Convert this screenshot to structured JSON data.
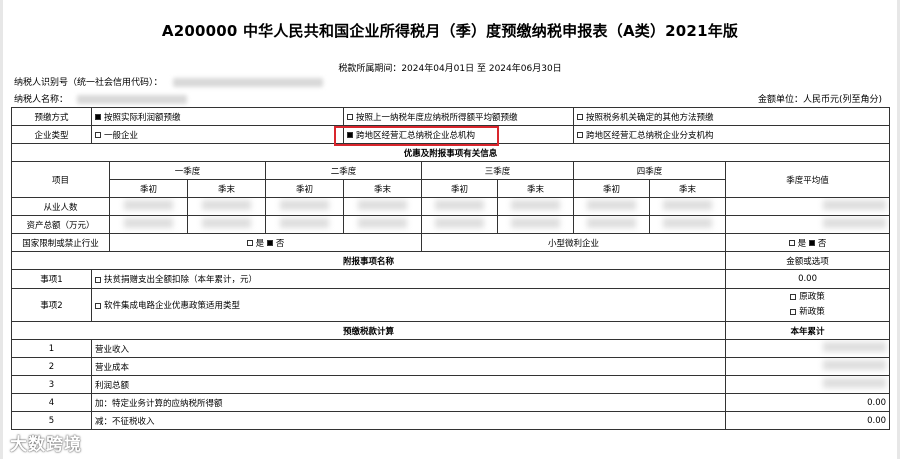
{
  "title": "A200000 中华人民共和国企业所得税月（季）度预缴纳税申报表（A类）2021年版",
  "period": "税款所属期间：2024年04月01日 至 2024年06月30日",
  "taxpayer_id_label": "纳税人识别号（统一社会信用代码）：",
  "taxpayer_name_label": "纳税人名称：",
  "amount_unit": "金额单位：人民币元(列至角分)",
  "prepay_method": {
    "label": "预缴方式",
    "options": [
      "按照实际利润额预缴",
      "按照上一纳税年度应纳税所得额平均额预缴",
      "按照税务机关确定的其他方法预缴"
    ]
  },
  "enterprise_type": {
    "label": "企业类型",
    "options": [
      "一般企业",
      "跨地区经营汇总纳税企业总机构",
      "跨地区经营汇总纳税企业分支机构"
    ]
  },
  "preferential_header": "优惠及附报事项有关信息",
  "item_label": "项目",
  "quarters": [
    "一季度",
    "二季度",
    "三季度",
    "四季度"
  ],
  "q_start": "季初",
  "q_end": "季末",
  "quarter_avg": "季度平均值",
  "rows": {
    "employees": "从业人数",
    "assets": "资产总额（万元）",
    "restricted": "国家限制或禁止行业",
    "small": "小型微利企业"
  },
  "yes": "是",
  "no": "否",
  "attach_header": "附报事项名称",
  "amount_or_option": "金额或选项",
  "item1": {
    "label": "事项1",
    "desc": "扶贫捐赠支出全额扣除（本年累计，元）",
    "value": "0.00"
  },
  "item2": {
    "label": "事项2",
    "desc": "软件集成电路企业优惠政策适用类型",
    "opt_a": "原政策",
    "opt_b": "新政策"
  },
  "calc_header": "预缴税款计算",
  "year_total": "本年累计",
  "calc_rows": [
    {
      "no": "1",
      "name": "营业收入",
      "value": ""
    },
    {
      "no": "2",
      "name": "营业成本",
      "value": ""
    },
    {
      "no": "3",
      "name": "利润总额",
      "value": ""
    },
    {
      "no": "4",
      "name": "加：特定业务计算的应纳税所得额",
      "value": "0.00"
    },
    {
      "no": "5",
      "name": "减：不征税收入",
      "value": "0.00"
    }
  ],
  "watermark": "大数跨境"
}
